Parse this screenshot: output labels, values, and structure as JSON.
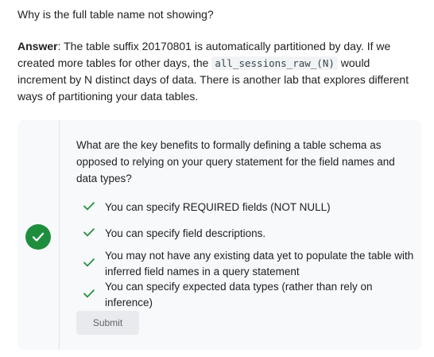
{
  "question_heading": "Why is the full table name not showing?",
  "answer": {
    "label": "Answer",
    "text_before_code": ": The table suffix 20170801 is automatically partitioned by day. If we created more tables for other days, the ",
    "code": "all_sessions_raw_(N)",
    "text_after_code": " would increment by N distinct days of data. There is another lab that explores different ways of partitioning your data tables."
  },
  "quiz": {
    "status_icon": "check-circle-icon",
    "prompt": "What are the key benefits to formally defining a table schema as opposed to relying on your query statement for the field names and data types?",
    "options": [
      {
        "label": "You can specify REQUIRED fields (NOT NULL)",
        "checked": true,
        "icon": "checkmark-icon"
      },
      {
        "label": "You can specify field descriptions.",
        "checked": true,
        "icon": "checkmark-icon"
      },
      {
        "label": "You may not have any existing data yet to populate the table with inferred field names in a query statement",
        "checked": true,
        "icon": "checkmark-icon"
      },
      {
        "label": "You can specify expected data types (rather than rely on inference)",
        "checked": true,
        "icon": "checkmark-icon"
      }
    ],
    "submit_label": "Submit"
  },
  "colors": {
    "check_green": "#1e8e3e",
    "card_background": "#f8f9fa",
    "submit_background": "#e8eaed"
  }
}
